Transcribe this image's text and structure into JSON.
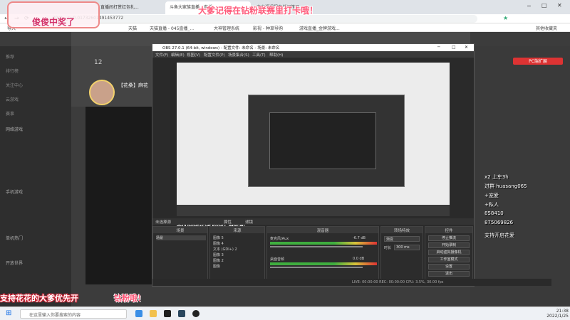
{
  "browser": {
    "tabs": [
      "直播间打赏红包礼...",
      "斗鱼大家族直播 - 直播...",
      "中文课课程直播间首页..."
    ],
    "url": "...09ct=_r=0.01732601491453772",
    "bookmarks": [
      "导入",
      "天猫",
      "天猫直播 - 045直播_...",
      "大神管理系统",
      "影视 - 种草导购",
      "游戏直播_金牌游戏...",
      "其他收藏夹"
    ]
  },
  "site": {
    "sidebar": [
      "推荐",
      "排行榜",
      "关注中心",
      "云游戏",
      "赛事"
    ],
    "sidebar_sections": [
      "网络游戏",
      "手机游戏",
      "单机热门",
      "开放世界"
    ],
    "streamer_name": "【花桑】麻花",
    "count": "12",
    "right_badge": "PC端扩展"
  },
  "obs": {
    "title": "OBS 27.0.1 (64-bit, windows) - 配置文件: 未命名 - 场景: 未命名",
    "menu": [
      "文件(F)",
      "编辑(E)",
      "视图(V)",
      "配置文件(P)",
      "场景集合(S)",
      "工具(T)",
      "帮助(H)"
    ],
    "preview_banner": "支持花花的大爹优先开 钻粉哦！",
    "not_selected": "未选择源",
    "properties_label": "属性",
    "filters_label": "滤镜",
    "docks": {
      "scenes": "场景",
      "sources": "来源",
      "mixer": "混音器",
      "transitions": "转场特效",
      "controls": "控件"
    },
    "scene_item": "场景",
    "sources": [
      "图像 5",
      "图像 4",
      "文本 (GDI+) 2",
      "图像 3",
      "图像 2",
      "图像"
    ],
    "mixer_tracks": [
      {
        "name": "麦克风/Aux",
        "db": "-6.7 dB"
      },
      {
        "name": "桌面音频",
        "db": "0.0 dB"
      }
    ],
    "transition": {
      "type": "渐变",
      "duration_label": "时长",
      "duration": "300 ms"
    },
    "controls": [
      "停止推流",
      "开始录制",
      "启动虚拟摄像机",
      "工作室模式",
      "设置",
      "退出"
    ],
    "status": {
      "live": "LIVE: 00:00:00",
      "rec": "REC: 00:00:00",
      "cpu": "CPU: 3.5%, 30.00 fps"
    }
  },
  "overlay": {
    "top": "大爹记得在钻粉联赛里打卡哦！",
    "bottom": "支持花花的大爹优先开",
    "bottom_tail": "钻粉哦！",
    "stamp": "俊俊中奖了",
    "stats": [
      "x2 上车3h",
      "进群 huasang065",
      "+宠爱",
      "+私人",
      "858410",
      "875069826",
      "支持开启花爱"
    ]
  },
  "taskbar": {
    "search_placeholder": "在这里输入你要搜索的内容",
    "time": "21:38",
    "date": "2022/1/25"
  }
}
